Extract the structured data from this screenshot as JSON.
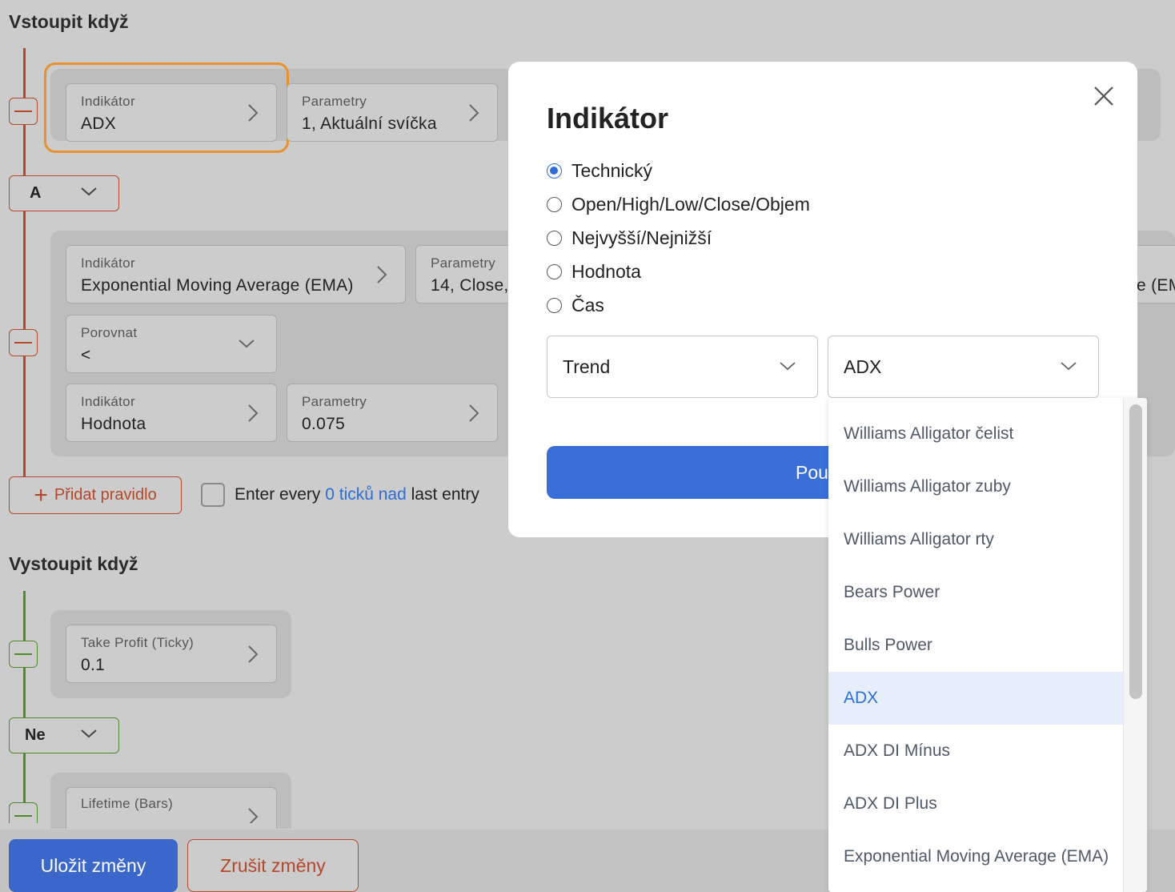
{
  "entry_section": {
    "title": "Vstoupit když",
    "rule1": {
      "indicator": {
        "label": "Indikátor",
        "value": "ADX"
      },
      "params": {
        "label": "Parametry",
        "value": "1, Aktuální svíčka"
      }
    },
    "logic_operator": "A",
    "rule2": {
      "indicator": {
        "label": "Indikátor",
        "value": "Exponential Moving Average (EMA)"
      },
      "params": {
        "label": "Parametry",
        "value": "14, Close,"
      },
      "right_partial": "e (EM",
      "compare": {
        "label": "Porovnat",
        "value": "<"
      },
      "indicator2": {
        "label": "Indikátor",
        "value": "Hodnota"
      },
      "params2": {
        "label": "Parametry",
        "value": "0.075"
      }
    },
    "add_rule_label": "Přidat pravidlo",
    "every": {
      "prefix": "Enter every ",
      "link": "0 ticků nad",
      "suffix": " last entry"
    }
  },
  "exit_section": {
    "title": "Vystoupit když",
    "take_profit": {
      "label": "Take Profit (Ticky)",
      "value": "0.1"
    },
    "logic_operator": "Ne",
    "lifetime": {
      "label": "Lifetime (Bars)"
    }
  },
  "footer": {
    "save_label": "Uložit změny",
    "cancel_label": "Zrušit změny"
  },
  "modal": {
    "title": "Indikátor",
    "radio_options": [
      {
        "label": "Technický",
        "checked": true
      },
      {
        "label": "Open/High/Low/Close/Objem",
        "checked": false
      },
      {
        "label": "Nejvyšší/Nejnižší",
        "checked": false
      },
      {
        "label": "Hodnota",
        "checked": false
      },
      {
        "label": "Čas",
        "checked": false
      }
    ],
    "category_select": "Trend",
    "indicator_select": "ADX",
    "apply_label_visible": "Pou"
  },
  "dropdown": {
    "items": [
      "Williams Alligator čelist",
      "Williams Alligator zuby",
      "Williams Alligator rty",
      "Bears Power",
      "Bulls Power",
      "ADX",
      "ADX DI Mínus",
      "ADX DI Plus",
      "Exponential Moving Average (EMA)"
    ],
    "selected": "ADX"
  },
  "colors": {
    "accent_blue": "#3a67c9",
    "entry_red": "#b5472b",
    "exit_green": "#4f8a2d",
    "focus_orange": "#e8912d"
  }
}
